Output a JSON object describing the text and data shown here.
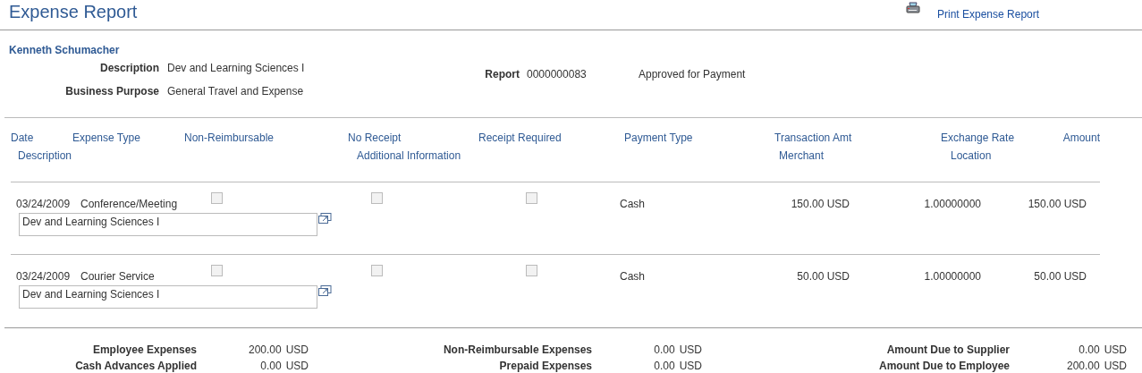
{
  "page": {
    "title": "Expense Report",
    "print_link": "Print Expense Report"
  },
  "employee": "Kenneth Schumacher",
  "details": [
    {
      "label": "Description",
      "value": "Dev and Learning Sciences I"
    },
    {
      "label": "Business Purpose",
      "value": "General Travel and Expense"
    }
  ],
  "report": {
    "label": "Report",
    "value": "0000000083",
    "status": "Approved for Payment"
  },
  "table": {
    "columns_line_1": [
      "Date",
      "Expense Type",
      "Non-Reimbursable",
      "No Receipt",
      "Receipt Required",
      "Payment Type",
      "Transaction Amt",
      "Exchange Rate",
      "Amount"
    ],
    "columns_line_2": [
      "Description",
      "Additional Information",
      "Merchant",
      "Location"
    ],
    "rows": [
      {
        "date": "03/24/2009",
        "expense_type": "Conference/Meeting",
        "non_reimbursable": false,
        "no_receipt": false,
        "receipt_required": false,
        "payment_type": "Cash",
        "transaction_amt": "150.00 USD",
        "exchange_rate": "1.00000000",
        "amount": "150.00 USD",
        "description": "Dev and Learning Sciences I"
      },
      {
        "date": "03/24/2009",
        "expense_type": "Courier Service",
        "non_reimbursable": false,
        "no_receipt": false,
        "receipt_required": false,
        "payment_type": "Cash",
        "transaction_amt": "50.00 USD",
        "exchange_rate": "1.00000000",
        "amount": "50.00 USD",
        "description": "Dev and Learning Sciences I"
      }
    ]
  },
  "totals": [
    [
      {
        "label": "Employee Expenses",
        "amount": "200.00",
        "currency": "USD"
      },
      {
        "label": "Cash Advances Applied",
        "amount": "0.00",
        "currency": "USD"
      }
    ],
    [
      {
        "label": "Non-Reimbursable Expenses",
        "amount": "0.00",
        "currency": "USD"
      },
      {
        "label": "Prepaid Expenses",
        "amount": "0.00",
        "currency": "USD"
      }
    ],
    [
      {
        "label": "Amount Due to Supplier",
        "amount": "0.00",
        "currency": "USD"
      },
      {
        "label": "Amount Due to Employee",
        "amount": "200.00",
        "currency": "USD"
      }
    ]
  ]
}
